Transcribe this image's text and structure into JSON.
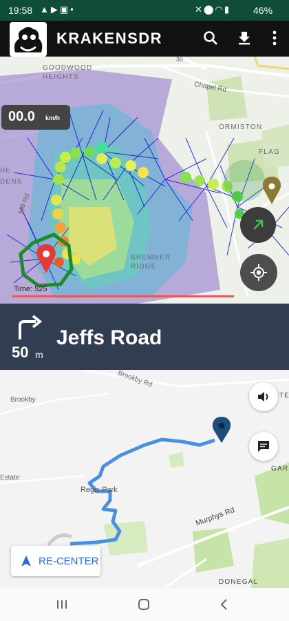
{
  "status_bar": {
    "time": "19:58",
    "battery": "46%",
    "left_icons": [
      "navigation-arrow-icon",
      "youtube-icon",
      "image-icon",
      "dot-icon"
    ],
    "right_icons": [
      "mute-icon",
      "location-icon",
      "wifi-icon",
      "signal-icon"
    ]
  },
  "app_bar": {
    "title": "KRAKENSDR",
    "actions": [
      "search-icon",
      "download-icon",
      "more-vert-icon"
    ]
  },
  "doa_map": {
    "speed_value": "00.0",
    "speed_unit": "km/h",
    "time_label": "Time: 525",
    "places": {
      "goodwood_heights": "GOODWOOD\nHEIGHTS",
      "ormiston": "ORMISTON",
      "flag": "FLAG",
      "bremner_ridge": "BREMNER\nRIDGE",
      "he": "HE",
      "dens": "DENS"
    },
    "streets": {
      "chapel_rd": "Chapel Rd",
      "mill_rd": "Mill Rd",
      "route_30": "30"
    },
    "colors": {
      "heatmap_purple": "#8a6fc9",
      "heatmap_yellow": "#f4e46a",
      "bearing_lines": "#1010d0",
      "track_green": "#7fd84a"
    }
  },
  "nav_banner": {
    "turn_icon": "turn-right-arrow-icon",
    "distance_value": "50",
    "distance_unit": "m",
    "street": "Jeffs Road"
  },
  "route_map": {
    "places": {
      "brookby": "Brookby",
      "regis_park": "Regis Park",
      "estate": "Estate",
      "donegal": "DONEGAL",
      "gar": "GAR",
      "ste": "STE"
    },
    "streets": {
      "brookby_rd": "Brookby Rd",
      "murphys_rd": "Murphys Rd"
    },
    "recenter_label": "RE-CENTER",
    "route_color": "#4a90e2"
  },
  "system_nav": [
    "recent-apps-icon",
    "home-icon",
    "back-icon"
  ]
}
